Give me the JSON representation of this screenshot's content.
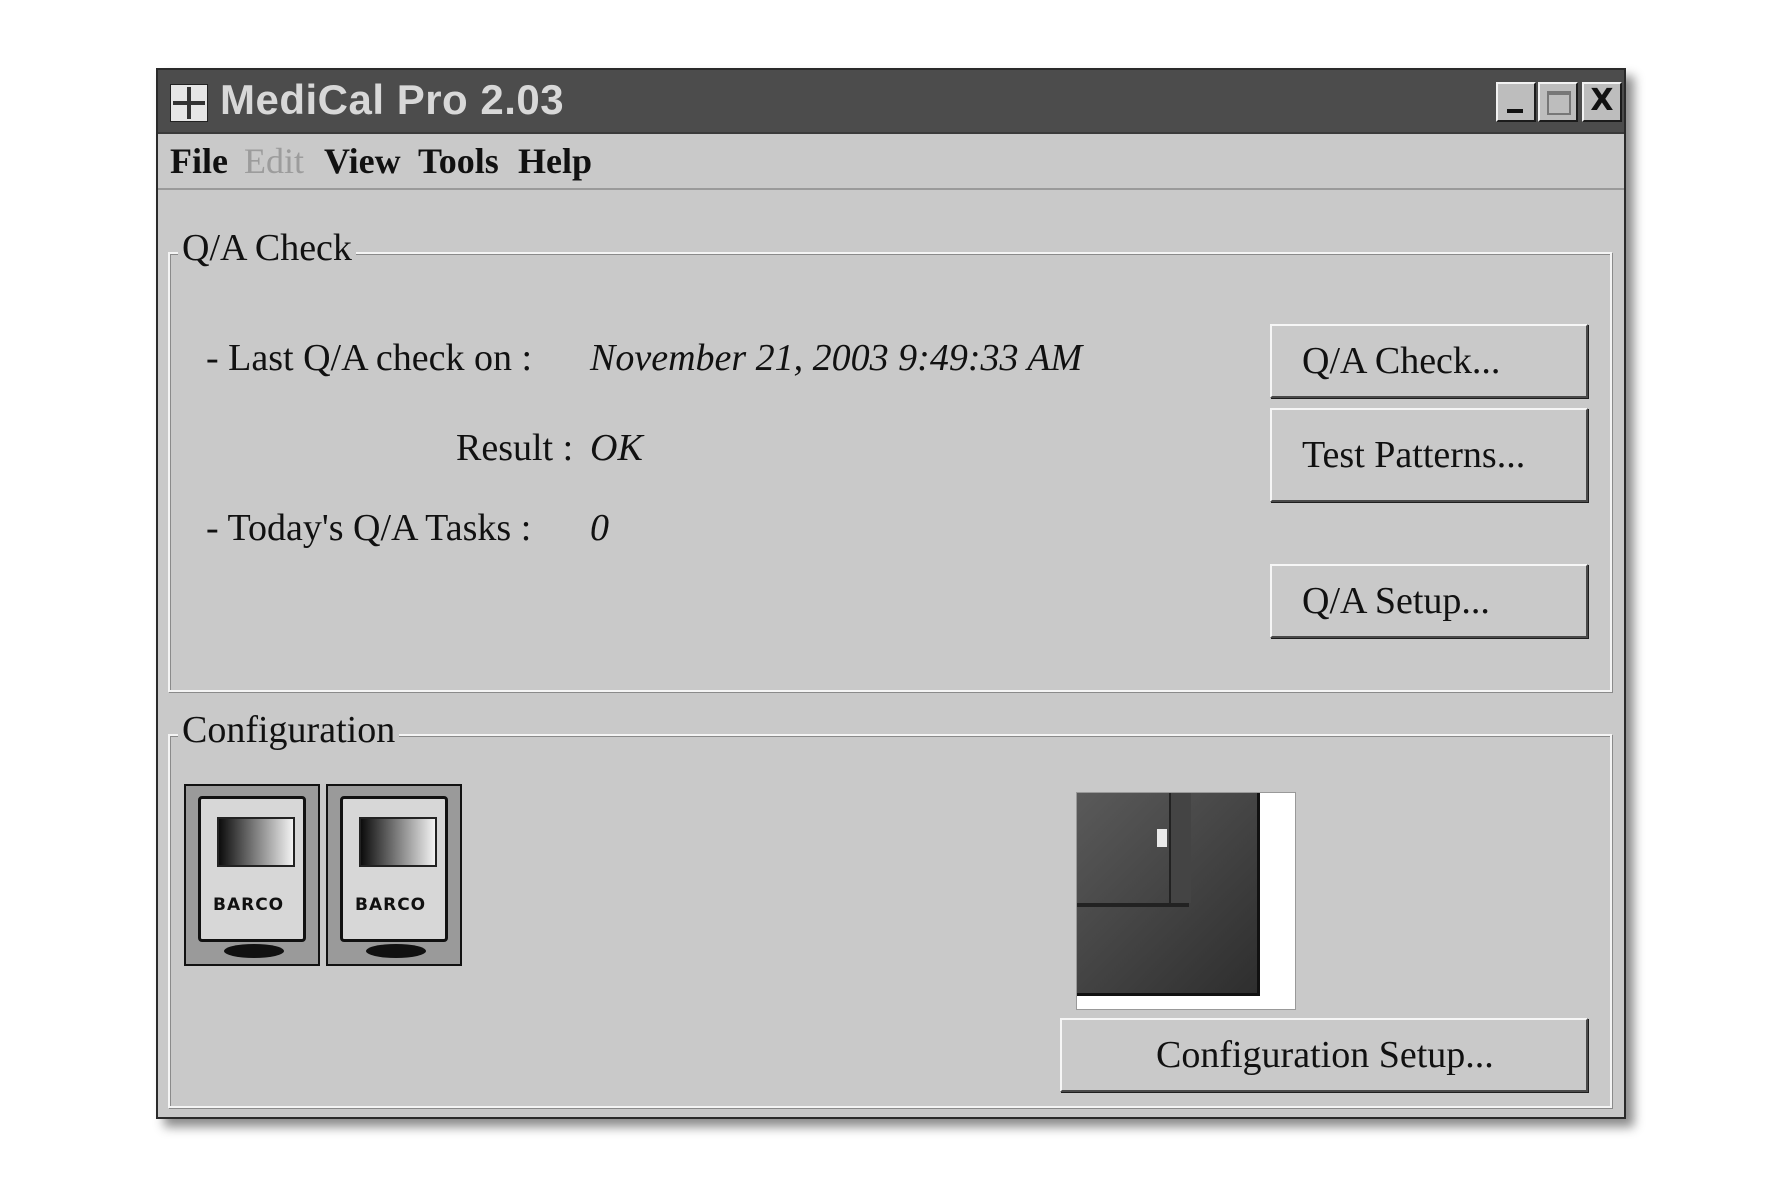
{
  "window": {
    "title": "MediCal Pro 2.03",
    "controls": {
      "minimize": "_",
      "maximize": "□",
      "close": "X"
    }
  },
  "menu": {
    "file": "File",
    "edit": "Edit",
    "view": "View",
    "tools": "Tools",
    "help": "Help"
  },
  "qa": {
    "title": "Q/A Check",
    "last_check_label": "- Last Q/A check on :",
    "last_check_value": "November 21, 2003 9:49:33 AM",
    "result_label": "Result :",
    "result_value": "OK",
    "tasks_label": "- Today's Q/A Tasks :",
    "tasks_value": "0",
    "buttons": {
      "qa_check": "Q/A Check...",
      "test_patterns": "Test Patterns...",
      "qa_setup": "Q/A Setup..."
    }
  },
  "configuration": {
    "title": "Configuration",
    "monitors": [
      {
        "brand": "BARCO"
      },
      {
        "brand": "BARCO"
      }
    ],
    "setup_button": "Configuration Setup..."
  },
  "icons": [
    "app-icon",
    "minimize-icon",
    "maximize-icon",
    "close-icon",
    "monitor-icon",
    "display-image"
  ]
}
